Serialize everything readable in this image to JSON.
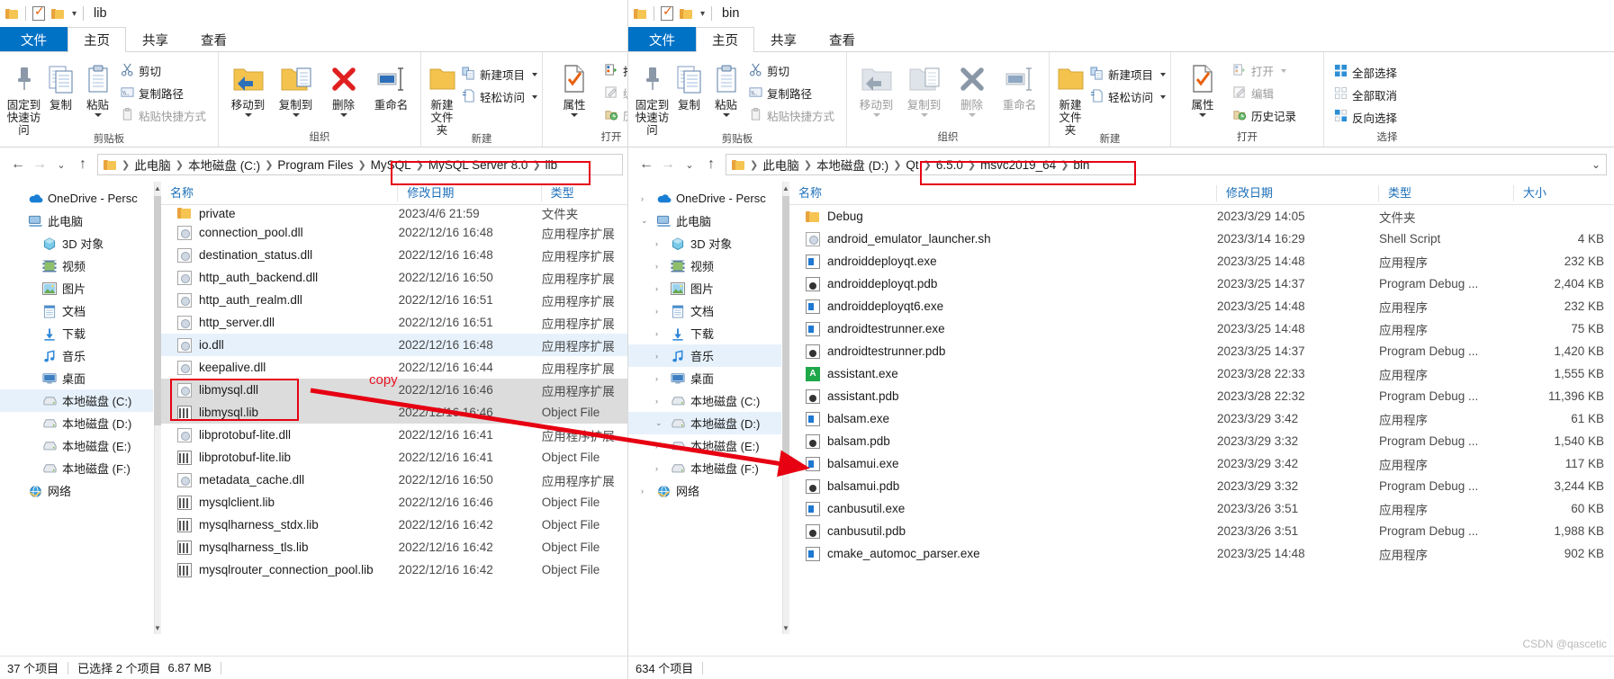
{
  "ribbon_tabs": [
    "文件",
    "主页",
    "共享",
    "查看"
  ],
  "ribbon": {
    "clipboard": {
      "label": "剪贴板",
      "pin": "固定到\n快速访问",
      "pin_l1": "固定到",
      "pin_l2": "快速访问",
      "copy": "复制",
      "paste": "粘贴",
      "cut": "剪切",
      "copy_path": "复制路径",
      "paste_shortcut": "粘贴快捷方式"
    },
    "organize": {
      "label": "组织",
      "move_to": "移动到",
      "copy_to": "复制到",
      "delete": "删除",
      "rename": "重命名"
    },
    "new": {
      "label": "新建",
      "new_folder_l1": "新建",
      "new_folder_l2": "文件夹",
      "new_item": "新建项目",
      "easy_access": "轻松访问"
    },
    "open": {
      "label": "打开",
      "properties": "属性",
      "open": "打开",
      "edit": "编辑",
      "history": "历史记录"
    },
    "select": {
      "label": "选择",
      "select_all": "全部选择",
      "select_none": "全部取消",
      "invert": "反向选择"
    }
  },
  "left_window": {
    "title": "lib",
    "address": [
      "此电脑",
      "本地磁盘 (C:)",
      "Program Files",
      "MySQL",
      "MySQL Server 8.0",
      "lib"
    ],
    "address_highlight_from": 3,
    "nav_items": [
      {
        "label": "OneDrive - Persc",
        "icon": "onedrive-icon",
        "indent": 0,
        "expander": ""
      },
      {
        "label": "此电脑",
        "icon": "pc-icon",
        "indent": 0,
        "expander": ""
      },
      {
        "label": "3D 对象",
        "icon": "3d-icon",
        "indent": 1,
        "expander": ""
      },
      {
        "label": "视频",
        "icon": "video-icon",
        "indent": 1,
        "expander": ""
      },
      {
        "label": "图片",
        "icon": "pictures-icon",
        "indent": 1,
        "expander": ""
      },
      {
        "label": "文档",
        "icon": "documents-icon",
        "indent": 1,
        "expander": ""
      },
      {
        "label": "下载",
        "icon": "downloads-icon",
        "indent": 1,
        "expander": ""
      },
      {
        "label": "音乐",
        "icon": "music-icon",
        "indent": 1,
        "expander": ""
      },
      {
        "label": "桌面",
        "icon": "desktop-icon",
        "indent": 1,
        "expander": ""
      },
      {
        "label": "本地磁盘 (C:)",
        "icon": "drive-icon",
        "indent": 1,
        "expander": "",
        "selected": true
      },
      {
        "label": "本地磁盘 (D:)",
        "icon": "drive-icon",
        "indent": 1,
        "expander": ""
      },
      {
        "label": "本地磁盘 (E:)",
        "icon": "drive-icon",
        "indent": 1,
        "expander": ""
      },
      {
        "label": "本地磁盘 (F:)",
        "icon": "drive-icon",
        "indent": 1,
        "expander": ""
      },
      {
        "label": "网络",
        "icon": "network-icon",
        "indent": 0,
        "expander": ""
      }
    ],
    "columns": [
      "名称",
      "修改日期",
      "类型"
    ],
    "files": [
      {
        "name": "private",
        "date": "2023/4/6 21:59",
        "type": "文件夹",
        "icon": "folder",
        "clipped": true
      },
      {
        "name": "connection_pool.dll",
        "date": "2022/12/16 16:48",
        "type": "应用程序扩展",
        "icon": "dll"
      },
      {
        "name": "destination_status.dll",
        "date": "2022/12/16 16:48",
        "type": "应用程序扩展",
        "icon": "dll"
      },
      {
        "name": "http_auth_backend.dll",
        "date": "2022/12/16 16:50",
        "type": "应用程序扩展",
        "icon": "dll"
      },
      {
        "name": "http_auth_realm.dll",
        "date": "2022/12/16 16:51",
        "type": "应用程序扩展",
        "icon": "dll"
      },
      {
        "name": "http_server.dll",
        "date": "2022/12/16 16:51",
        "type": "应用程序扩展",
        "icon": "dll"
      },
      {
        "name": "io.dll",
        "date": "2022/12/16 16:48",
        "type": "应用程序扩展",
        "icon": "dll",
        "highlight": "light"
      },
      {
        "name": "keepalive.dll",
        "date": "2022/12/16 16:44",
        "type": "应用程序扩展",
        "icon": "dll"
      },
      {
        "name": "libmysql.dll",
        "date": "2022/12/16 16:46",
        "type": "应用程序扩展",
        "icon": "dll",
        "highlight": "grey"
      },
      {
        "name": "libmysql.lib",
        "date": "2022/12/16 16:46",
        "type": "Object File",
        "icon": "lib",
        "highlight": "grey"
      },
      {
        "name": "libprotobuf-lite.dll",
        "date": "2022/12/16 16:41",
        "type": "应用程序扩展",
        "icon": "dll"
      },
      {
        "name": "libprotobuf-lite.lib",
        "date": "2022/12/16 16:41",
        "type": "Object File",
        "icon": "lib"
      },
      {
        "name": "metadata_cache.dll",
        "date": "2022/12/16 16:50",
        "type": "应用程序扩展",
        "icon": "dll"
      },
      {
        "name": "mysqlclient.lib",
        "date": "2022/12/16 16:46",
        "type": "Object File",
        "icon": "lib"
      },
      {
        "name": "mysqlharness_stdx.lib",
        "date": "2022/12/16 16:42",
        "type": "Object File",
        "icon": "lib"
      },
      {
        "name": "mysqlharness_tls.lib",
        "date": "2022/12/16 16:42",
        "type": "Object File",
        "icon": "lib"
      },
      {
        "name": "mysqlrouter_connection_pool.lib",
        "date": "2022/12/16 16:42",
        "type": "Object File",
        "icon": "lib"
      }
    ],
    "status": {
      "count": "37 个项目",
      "selected": "已选择 2 个项目",
      "size": "6.87 MB"
    }
  },
  "right_window": {
    "title": "bin",
    "address": [
      "此电脑",
      "本地磁盘 (D:)",
      "Qt",
      "6.5.0",
      "msvc2019_64",
      "bin"
    ],
    "nav_items": [
      {
        "label": "OneDrive - Persc",
        "icon": "onedrive-icon",
        "indent": 0,
        "expander": "›"
      },
      {
        "label": "此电脑",
        "icon": "pc-icon",
        "indent": 0,
        "expander": "⌄"
      },
      {
        "label": "3D 对象",
        "icon": "3d-icon",
        "indent": 1,
        "expander": "›"
      },
      {
        "label": "视频",
        "icon": "video-icon",
        "indent": 1,
        "expander": "›"
      },
      {
        "label": "图片",
        "icon": "pictures-icon",
        "indent": 1,
        "expander": "›"
      },
      {
        "label": "文档",
        "icon": "documents-icon",
        "indent": 1,
        "expander": "›"
      },
      {
        "label": "下载",
        "icon": "downloads-icon",
        "indent": 1,
        "expander": "›"
      },
      {
        "label": "音乐",
        "icon": "music-icon",
        "indent": 1,
        "expander": "›",
        "selected": true
      },
      {
        "label": "桌面",
        "icon": "desktop-icon",
        "indent": 1,
        "expander": "›"
      },
      {
        "label": "本地磁盘 (C:)",
        "icon": "drive-icon",
        "indent": 1,
        "expander": "›"
      },
      {
        "label": "本地磁盘 (D:)",
        "icon": "drive-icon",
        "indent": 1,
        "expander": "⌄",
        "selected": true
      },
      {
        "label": "本地磁盘 (E:)",
        "icon": "drive-icon",
        "indent": 1,
        "expander": "›"
      },
      {
        "label": "本地磁盘 (F:)",
        "icon": "drive-icon",
        "indent": 1,
        "expander": "›"
      },
      {
        "label": "网络",
        "icon": "network-icon",
        "indent": 0,
        "expander": "›"
      }
    ],
    "columns": [
      "名称",
      "修改日期",
      "类型",
      "大小"
    ],
    "files": [
      {
        "name": "Debug",
        "date": "2023/3/29 14:05",
        "type": "文件夹",
        "size": "",
        "icon": "folder"
      },
      {
        "name": "android_emulator_launcher.sh",
        "date": "2023/3/14 16:29",
        "type": "Shell Script",
        "size": "4 KB",
        "icon": "sh"
      },
      {
        "name": "androiddeployqt.exe",
        "date": "2023/3/25 14:48",
        "type": "应用程序",
        "size": "232 KB",
        "icon": "exe"
      },
      {
        "name": "androiddeployqt.pdb",
        "date": "2023/3/25 14:37",
        "type": "Program Debug ...",
        "size": "2,404 KB",
        "icon": "pdb"
      },
      {
        "name": "androiddeployqt6.exe",
        "date": "2023/3/25 14:48",
        "type": "应用程序",
        "size": "232 KB",
        "icon": "exe"
      },
      {
        "name": "androidtestrunner.exe",
        "date": "2023/3/25 14:48",
        "type": "应用程序",
        "size": "75 KB",
        "icon": "exe"
      },
      {
        "name": "androidtestrunner.pdb",
        "date": "2023/3/25 14:37",
        "type": "Program Debug ...",
        "size": "1,420 KB",
        "icon": "pdb"
      },
      {
        "name": "assistant.exe",
        "date": "2023/3/28 22:33",
        "type": "应用程序",
        "size": "1,555 KB",
        "icon": "assist"
      },
      {
        "name": "assistant.pdb",
        "date": "2023/3/28 22:32",
        "type": "Program Debug ...",
        "size": "11,396 KB",
        "icon": "pdb"
      },
      {
        "name": "balsam.exe",
        "date": "2023/3/29 3:42",
        "type": "应用程序",
        "size": "61 KB",
        "icon": "exe"
      },
      {
        "name": "balsam.pdb",
        "date": "2023/3/29 3:32",
        "type": "Program Debug ...",
        "size": "1,540 KB",
        "icon": "pdb"
      },
      {
        "name": "balsamui.exe",
        "date": "2023/3/29 3:42",
        "type": "应用程序",
        "size": "117 KB",
        "icon": "exe"
      },
      {
        "name": "balsamui.pdb",
        "date": "2023/3/29 3:32",
        "type": "Program Debug ...",
        "size": "3,244 KB",
        "icon": "pdb"
      },
      {
        "name": "canbusutil.exe",
        "date": "2023/3/26 3:51",
        "type": "应用程序",
        "size": "60 KB",
        "icon": "exe"
      },
      {
        "name": "canbusutil.pdb",
        "date": "2023/3/26 3:51",
        "type": "Program Debug ...",
        "size": "1,988 KB",
        "icon": "pdb"
      },
      {
        "name": "cmake_automoc_parser.exe",
        "date": "2023/3/25 14:48",
        "type": "应用程序",
        "size": "902 KB",
        "icon": "exe"
      }
    ],
    "status": {
      "count": "634 个项目"
    }
  },
  "annotations": {
    "copy_label": "copy",
    "arrow_color": "#e60012",
    "box_color": "#e60012"
  },
  "watermark": "CSDN @qascetic"
}
